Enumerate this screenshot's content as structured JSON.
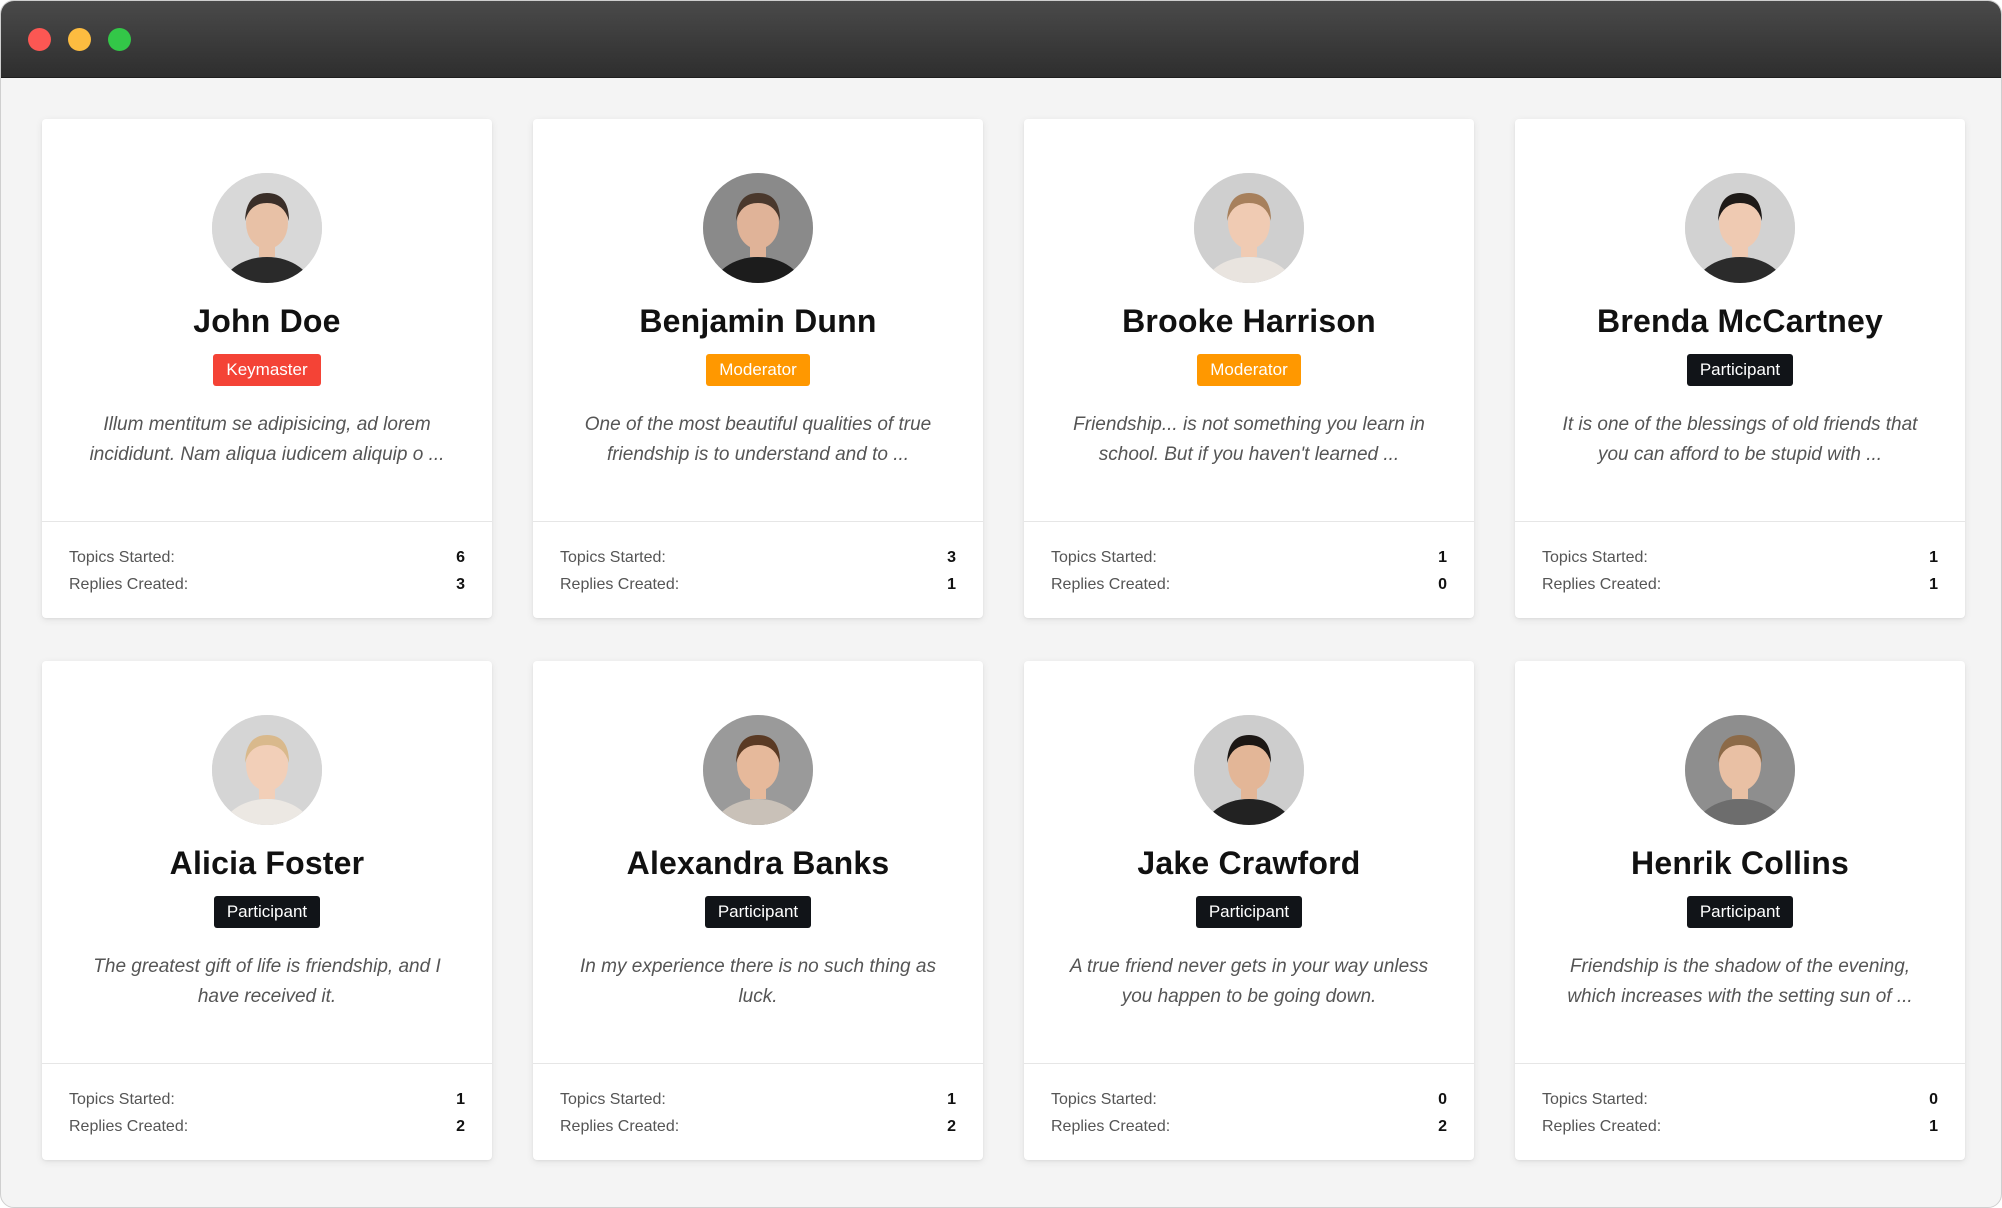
{
  "window": {
    "controls": [
      "close",
      "minimize",
      "maximize"
    ],
    "colors": {
      "close": "#fc5753",
      "minimize": "#fdbc40",
      "maximize": "#33c748"
    }
  },
  "labels": {
    "topics": "Topics Started:",
    "replies": "Replies Created:"
  },
  "roles": {
    "Keymaster": "#f44336",
    "Moderator": "#ff9800",
    "Participant": "#111418"
  },
  "members": [
    {
      "name": "John Doe",
      "role": "Keymaster",
      "bio": "Illum mentitum se adipisicing, ad lorem incididunt. Nam aliqua iudicem aliquip o ...",
      "topics": "6",
      "replies": "3",
      "avatar": {
        "bg": "#d8d8d8",
        "skin": "#e8c1a6",
        "hair": "#3a2e28",
        "shirt": "#2a2a2a"
      }
    },
    {
      "name": "Benjamin Dunn",
      "role": "Moderator",
      "bio": "One of the most beautiful qualities of true friendship is to understand and to ...",
      "topics": "3",
      "replies": "1",
      "avatar": {
        "bg": "#8a8a8a",
        "skin": "#e0b398",
        "hair": "#4a382c",
        "shirt": "#1c1c1c"
      }
    },
    {
      "name": "Brooke Harrison",
      "role": "Moderator",
      "bio": "Friendship... is not something you learn in school. But if you haven't learned ...",
      "topics": "1",
      "replies": "0",
      "avatar": {
        "bg": "#cfcfcf",
        "skin": "#f0cbb3",
        "hair": "#a7805c",
        "shirt": "#e9e4df"
      }
    },
    {
      "name": "Brenda McCartney",
      "role": "Participant",
      "bio": "It is one of the blessings of old friends that you can afford to be stupid with ...",
      "topics": "1",
      "replies": "1",
      "avatar": {
        "bg": "#d2d2d2",
        "skin": "#efcab2",
        "hair": "#1e1a18",
        "shirt": "#2b2b2b"
      }
    },
    {
      "name": "Alicia Foster",
      "role": "Participant",
      "bio": "The greatest gift of life is friendship, and I have received it.",
      "topics": "1",
      "replies": "2",
      "avatar": {
        "bg": "#d5d5d5",
        "skin": "#f2cfb8",
        "hair": "#d9b98c",
        "shirt": "#ece8e3"
      }
    },
    {
      "name": "Alexandra Banks",
      "role": "Participant",
      "bio": "In my experience there is no such thing as luck.",
      "topics": "1",
      "replies": "2",
      "avatar": {
        "bg": "#9a9a9a",
        "skin": "#e6b99b",
        "hair": "#5a3a24",
        "shirt": "#c9c1b8"
      }
    },
    {
      "name": "Jake Crawford",
      "role": "Participant",
      "bio": "A true friend never gets in your way unless you happen to be going down.",
      "topics": "0",
      "replies": "2",
      "avatar": {
        "bg": "#cdcdcd",
        "skin": "#e3b697",
        "hair": "#1c1714",
        "shirt": "#222222"
      }
    },
    {
      "name": "Henrik Collins",
      "role": "Participant",
      "bio": "Friendship is the shadow of the evening, which increases with the setting sun of ...",
      "topics": "0",
      "replies": "1",
      "avatar": {
        "bg": "#8e8e8e",
        "skin": "#e9c0a4",
        "hair": "#8c6a48",
        "shirt": "#6d6d6d"
      }
    }
  ]
}
